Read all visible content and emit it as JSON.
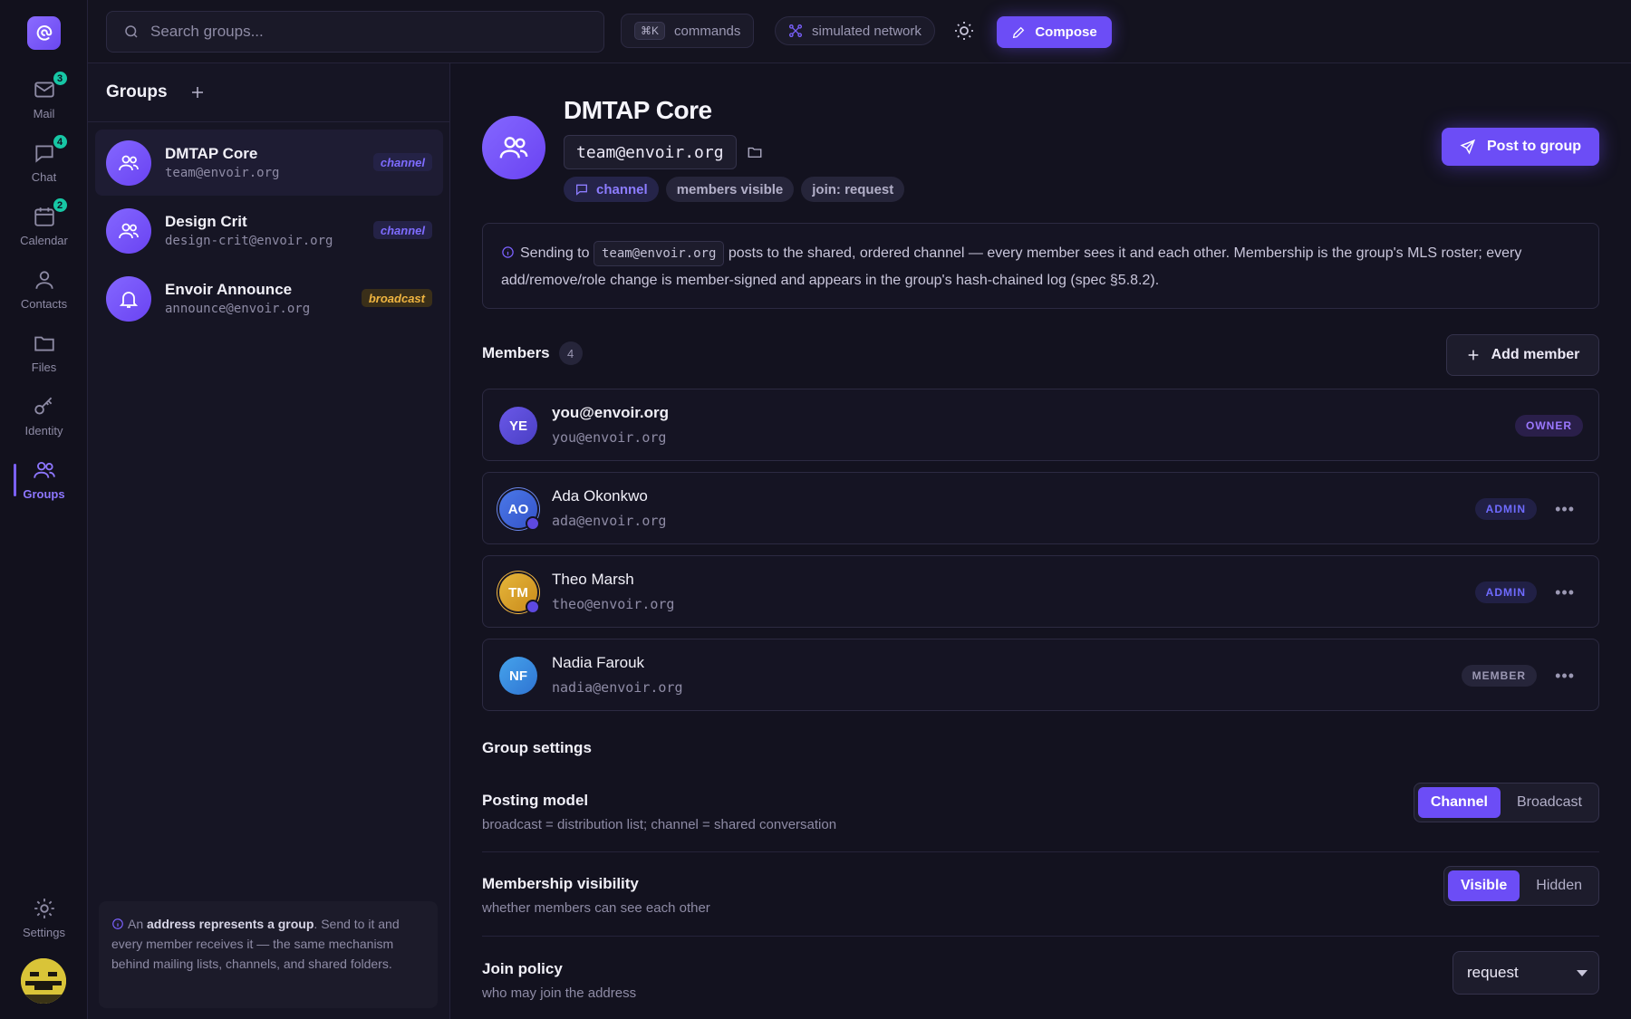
{
  "app": {
    "logo_icon": "envoir-logo-icon"
  },
  "rail": {
    "items": [
      {
        "id": "mail",
        "label": "Mail",
        "icon": "mail-icon",
        "badge": "3"
      },
      {
        "id": "chat",
        "label": "Chat",
        "icon": "chat-icon",
        "badge": "4"
      },
      {
        "id": "calendar",
        "label": "Calendar",
        "icon": "calendar-icon",
        "badge": "2"
      },
      {
        "id": "contacts",
        "label": "Contacts",
        "icon": "contacts-icon",
        "badge": null
      },
      {
        "id": "files",
        "label": "Files",
        "icon": "folder-icon",
        "badge": null
      },
      {
        "id": "identity",
        "label": "Identity",
        "icon": "key-icon",
        "badge": null
      },
      {
        "id": "groups",
        "label": "Groups",
        "icon": "groups-icon",
        "badge": null,
        "active": true
      }
    ],
    "settings_label": "Settings"
  },
  "topbar": {
    "search_placeholder": "Search groups...",
    "commands_kbd": "⌘K",
    "commands_label": "commands",
    "network_label": "simulated network",
    "compose_label": "Compose"
  },
  "groups": {
    "title": "Groups",
    "list": [
      {
        "name": "DMTAP Core",
        "address": "team@envoir.org",
        "tag": "channel",
        "icon": "users-icon",
        "selected": true
      },
      {
        "name": "Design Crit",
        "address": "design-crit@envoir.org",
        "tag": "channel",
        "icon": "users-icon"
      },
      {
        "name": "Envoir Announce",
        "address": "announce@envoir.org",
        "tag": "broadcast",
        "icon": "bell-icon"
      }
    ],
    "info": {
      "prefix": "An ",
      "bold": "address represents a group",
      "rest": ". Send to it and every member receives it — the same mechanism behind mailing lists, channels, and shared folders."
    }
  },
  "detail": {
    "title": "DMTAP Core",
    "address": "team@envoir.org",
    "chips": {
      "type": "channel",
      "visibility": "members visible",
      "join": "join: request"
    },
    "post_label": "Post to group",
    "notice": {
      "prefix": "Sending to",
      "code": "team@envoir.org",
      "rest": "posts to the shared, ordered channel — every member sees it and each other. Membership is the group's MLS roster; every add/remove/role change is member-signed and appears in the group's hash-chained log (spec §5.8.2)."
    },
    "members_title": "Members",
    "members_count": "4",
    "add_member_label": "Add member",
    "members": [
      {
        "initials": "YE",
        "name": "you@envoir.org",
        "email": "you@envoir.org",
        "role": "OWNER",
        "color": "#5747d6"
      },
      {
        "initials": "AO",
        "name": "Ada Okonkwo",
        "email": "ada@envoir.org",
        "role": "ADMIN",
        "color": "#3c63d9"
      },
      {
        "initials": "TM",
        "name": "Theo Marsh",
        "email": "theo@envoir.org",
        "role": "ADMIN",
        "color": "#d9a126"
      },
      {
        "initials": "NF",
        "name": "Nadia Farouk",
        "email": "nadia@envoir.org",
        "role": "MEMBER",
        "color": "#3a8fe0"
      }
    ],
    "settings": {
      "title": "Group settings",
      "posting": {
        "label": "Posting model",
        "desc": "broadcast = distribution list; channel = shared conversation",
        "options": [
          "Channel",
          "Broadcast"
        ],
        "selected": "Channel"
      },
      "visibility": {
        "label": "Membership visibility",
        "desc": "whether members can see each other",
        "options": [
          "Visible",
          "Hidden"
        ],
        "selected": "Visible"
      },
      "join": {
        "label": "Join policy",
        "desc": "who may join the address",
        "value": "request"
      }
    }
  }
}
